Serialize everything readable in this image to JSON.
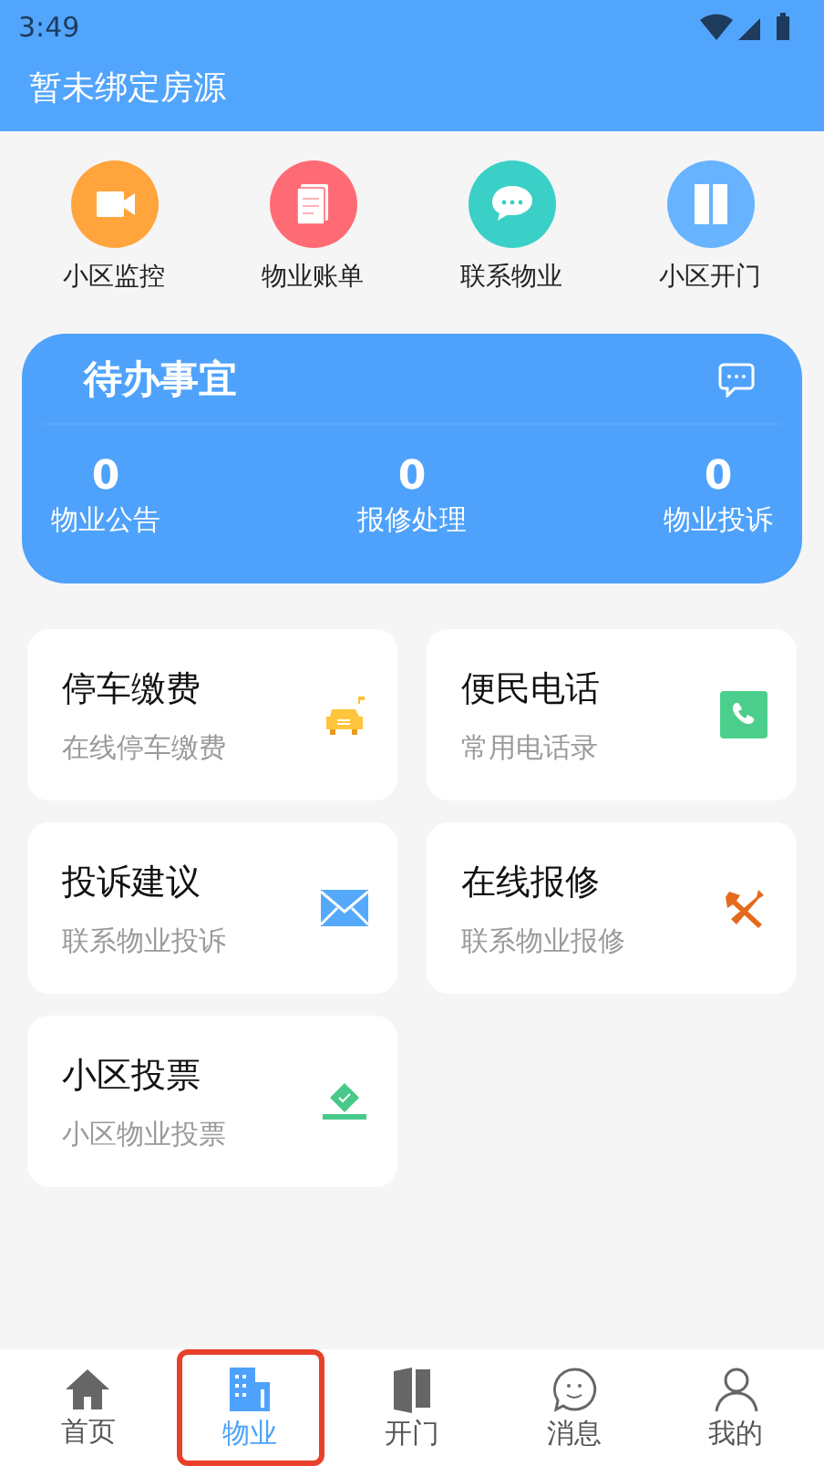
{
  "status_bar": {
    "time": "3:49"
  },
  "header": {
    "title": "暂未绑定房源"
  },
  "shortcuts": [
    {
      "label": "小区监控",
      "kind": "camera",
      "color": "#ffa53c"
    },
    {
      "label": "物业账单",
      "kind": "bill",
      "color": "#ff6b74"
    },
    {
      "label": "联系物业",
      "kind": "chat",
      "color": "#3ad0c7"
    },
    {
      "label": "小区开门",
      "kind": "door",
      "color": "#67b3ff"
    }
  ],
  "todo": {
    "title": "待办事宜",
    "stats": [
      {
        "value": "0",
        "label": "物业公告"
      },
      {
        "value": "0",
        "label": "报修处理"
      },
      {
        "value": "0",
        "label": "物业投诉"
      }
    ]
  },
  "services": [
    {
      "title": "停车缴费",
      "subtitle": "在线停车缴费",
      "kind": "car"
    },
    {
      "title": "便民电话",
      "subtitle": "常用电话录",
      "kind": "phone"
    },
    {
      "title": "投诉建议",
      "subtitle": "联系物业投诉",
      "kind": "mail"
    },
    {
      "title": "在线报修",
      "subtitle": "联系物业报修",
      "kind": "tools"
    },
    {
      "title": "小区投票",
      "subtitle": "小区物业投票",
      "kind": "vote"
    }
  ],
  "tab_bar": [
    {
      "label": "首页",
      "kind": "home",
      "selected": false
    },
    {
      "label": "物业",
      "kind": "building",
      "selected": true
    },
    {
      "label": "开门",
      "kind": "door",
      "selected": false
    },
    {
      "label": "消息",
      "kind": "message",
      "selected": false
    },
    {
      "label": "我的",
      "kind": "user",
      "selected": false
    }
  ]
}
